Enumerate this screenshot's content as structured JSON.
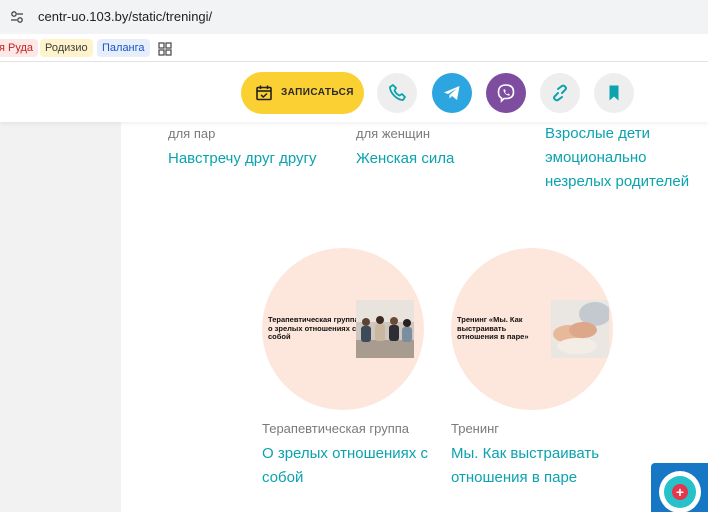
{
  "browser": {
    "url": "centr-uo.103.by/static/treningi/",
    "bookmarks": [
      "я Руда",
      "Родизио",
      "Паланга"
    ]
  },
  "header": {
    "signup_label": "ЗАПИСАТЬСЯ",
    "icons": [
      "calendar-icon",
      "phone-icon",
      "telegram-icon",
      "viber-icon",
      "link-icon",
      "bookmark-icon"
    ]
  },
  "cards_top": [
    {
      "category": "для пар",
      "title": "Навстречу друг другу"
    },
    {
      "category": "для женщин",
      "title": "Женская сила"
    },
    {
      "category": "",
      "title": "Взрослые дети эмоционально незрелых родителей"
    }
  ],
  "cards_bottom": [
    {
      "thumb_text": "Терапевтическая группа о зрелых отношениях с собой",
      "category": "Терапевтическая группа",
      "title": "О зрелых отношениях с собой"
    },
    {
      "thumb_text": "Тренинг «Мы. Как выстраивать отношения в паре»",
      "category": "Тренинг",
      "title": "Мы. Как выстраивать отношения в паре"
    }
  ],
  "colors": {
    "accent": "#0aa3ae",
    "signup_bg": "#fbd033",
    "circle_bg": "#fde7dc",
    "telegram": "#2ca5e0",
    "viber": "#7f4da0",
    "help_bg": "#1777c4"
  }
}
